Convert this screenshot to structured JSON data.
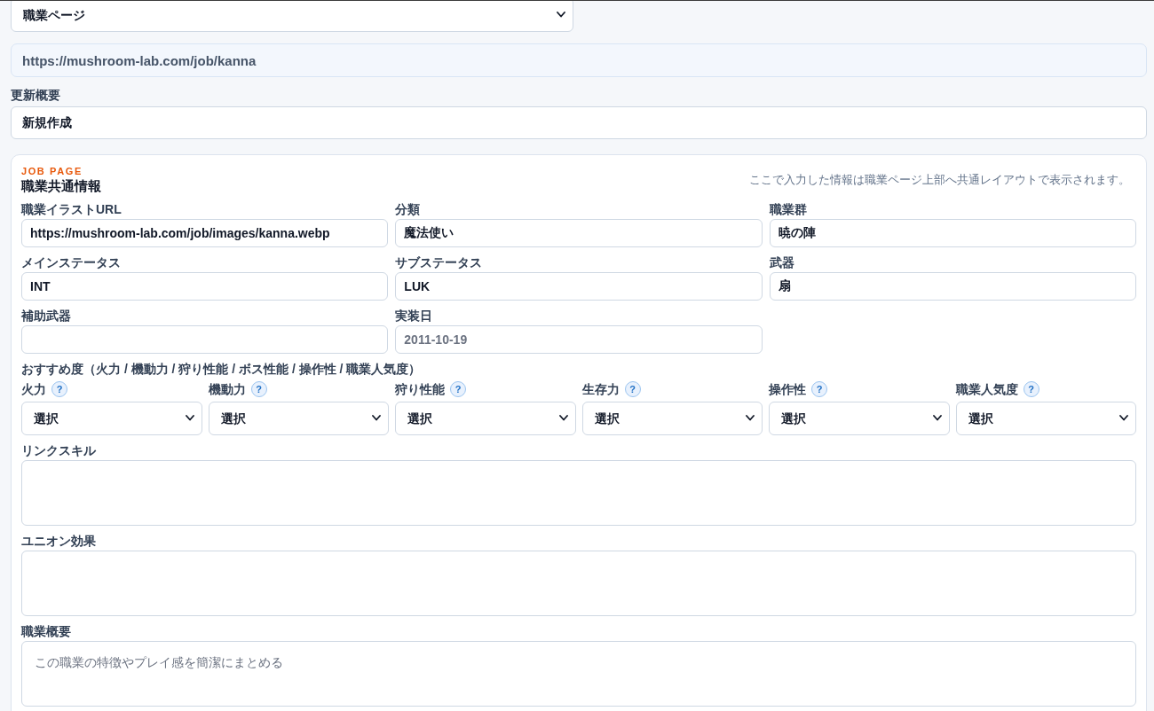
{
  "page_select": {
    "value": "職業ページ"
  },
  "url": "https://mushroom-lab.com/job/kanna",
  "update_summary": {
    "label": "更新概要",
    "value": "新規作成"
  },
  "job_section": {
    "eyebrow": "JOB PAGE",
    "title": "職業共通情報",
    "note": "ここで入力した情報は職業ページ上部へ共通レイアウトで表示されます。",
    "fields": [
      {
        "label": "職業イラストURL",
        "value": "https://mushroom-lab.com/job/images/kanna.webp"
      },
      {
        "label": "分類",
        "value": "魔法使い"
      },
      {
        "label": "職業群",
        "value": "暁の陣"
      },
      {
        "label": "メインステータス",
        "value": "INT"
      },
      {
        "label": "サブステータス",
        "value": "LUK"
      },
      {
        "label": "武器",
        "value": "扇"
      },
      {
        "label": "補助武器"
      },
      {
        "label": "実装日",
        "placeholder": "2011-10-19"
      }
    ],
    "rating": {
      "title": "おすすめ度（火力 / 機動力 / 狩り性能 / ボス性能 / 操作性 / 職業人気度）",
      "items": [
        {
          "label": "火力",
          "help": "?",
          "value": "選択"
        },
        {
          "label": "機動力",
          "help": "?",
          "value": "選択"
        },
        {
          "label": "狩り性能",
          "help": "?",
          "value": "選択"
        },
        {
          "label": "生存力",
          "help": "?",
          "value": "選択"
        },
        {
          "label": "操作性",
          "help": "?",
          "value": "選択"
        },
        {
          "label": "職業人気度",
          "help": "?",
          "value": "選択"
        }
      ]
    },
    "text_areas": [
      {
        "label": "リンクスキル"
      },
      {
        "label": "ユニオン効果"
      },
      {
        "label": "職業概要",
        "placeholder": "この職業の特徴やプレイ感を簡潔にまとめる"
      }
    ]
  }
}
